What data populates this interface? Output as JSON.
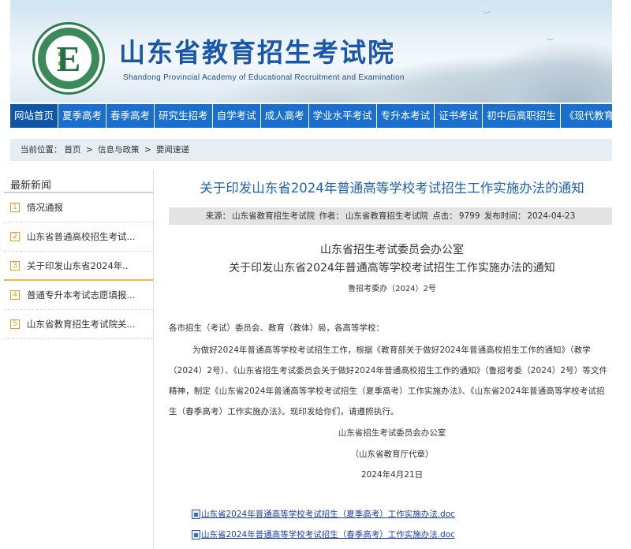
{
  "header": {
    "site_title": "山东省教育招生考试院",
    "site_subtitle": "Shandong Provincial Academy of Educational Recruitment and Examination",
    "logo_letter": "E",
    "logo_ring_text": "Shandong Educational Admission & Examination · 山东教育招生考试",
    "colors": {
      "title": "#1a57a8",
      "nav": "#1a6fcc",
      "link": "#1b62b4"
    }
  },
  "nav": {
    "items": [
      "网站首页",
      "夏季高考",
      "春季高考",
      "研究生招考",
      "自学考试",
      "成人高考",
      "学业水平考试",
      "专升本考试",
      "证书考试",
      "初中后高职招生",
      "《现代教育》"
    ]
  },
  "breadcrumb": {
    "prefix": "当前位置：",
    "items": [
      "首页",
      ">",
      "信息与政策",
      ">",
      "要闻速递"
    ]
  },
  "sidebar": {
    "title": "最新新闻",
    "items": [
      {
        "num": "1",
        "label": "情况通报"
      },
      {
        "num": "2",
        "label": "山东省普通高校招生考试..."
      },
      {
        "num": "3",
        "label": "关于印发山东省2024年.."
      },
      {
        "num": "4",
        "label": "普通专升本考试志愿填报..."
      },
      {
        "num": "5",
        "label": "山东省教育招生考试院关..."
      }
    ]
  },
  "article": {
    "title": "关于印发山东省2024年普通高等学校考试招生工作实施办法的通知",
    "meta": {
      "source_label": "来源：",
      "source": "山东省教育招生考试院",
      "author_label": "作者：",
      "author": "山东省教育招生考试院",
      "clicks_label": "点击：",
      "clicks": "9799",
      "date_label": "发布时间：",
      "date": "2024-04-23"
    },
    "doc_org": "山东省招生考试委员会办公室",
    "doc_title": "关于印发山东省2024年普通高等学校考试招生工作实施办法的通知",
    "doc_number": "鲁招考委办（2024）2号",
    "salutation": "各市招生（考试）委员会、教育（教体）局，各高等学校：",
    "paragraph": "为做好2024年普通高等学校考试招生工作，根据《教育部关于做好2024年普通高校招生工作的通知》（教学（2024）2号）、《山东省招生考试委员会关于做好2024年普通高校招生工作的通知》（鲁招考委（2024）2号）等文件精神，制定《山东省2024年普通高等学校考试招生（夏季高考）工作实施办法》、《山东省2024年普通高等学校考试招生（春季高考）工作实施办法》。现印发给你们，请遵照执行。",
    "signature_org": "山东省招生考试委员会办公室",
    "signature_proxy": "（山东省教育厅代章）",
    "signature_date": "2024年4月21日",
    "attachments": [
      "山东省2024年普通高等学校考试招生（夏季高考）工作实施办法.doc",
      "山东省2024年普通高等学校考试招生（春季高考）工作实施办法.doc"
    ]
  }
}
